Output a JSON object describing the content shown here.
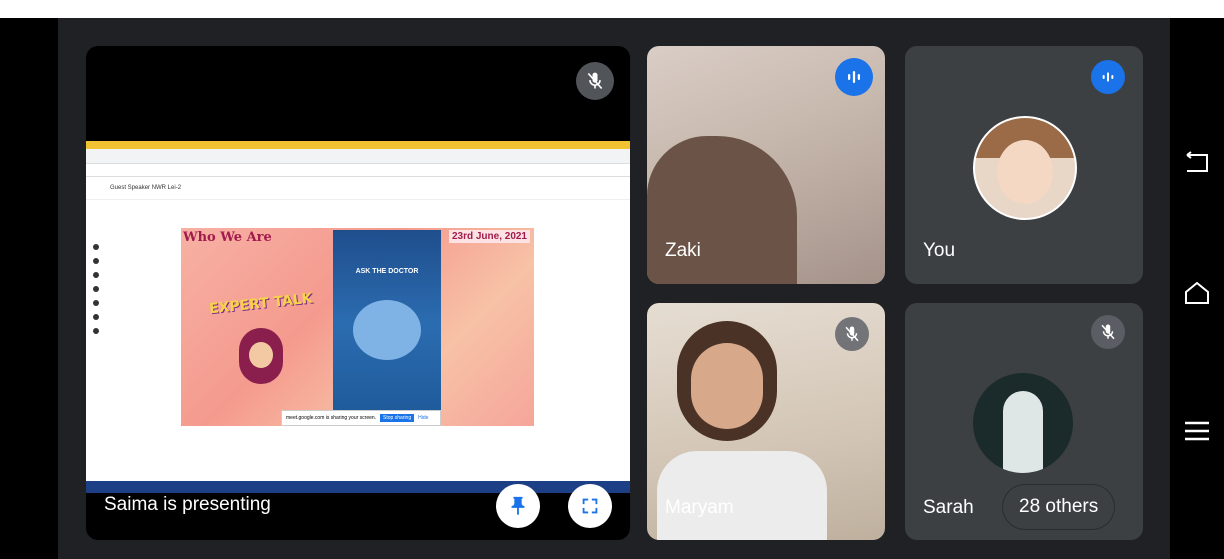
{
  "presentation": {
    "label": "Saima is presenting",
    "slide_title": "Who We Are",
    "slide_date": "23rd June, 2021",
    "slide_art_text": "EXPERT TALK",
    "poster_heading": "ASK THE DOCTOR",
    "doc_title": "Guest Speaker NWR Lei-2",
    "share_notice": "meet.google.com is sharing your screen.",
    "stop_sharing": "Stop sharing",
    "hide": "Hide"
  },
  "participants": [
    {
      "name": "Zaki",
      "state": "speaking"
    },
    {
      "name": "You",
      "state": "speaking"
    },
    {
      "name": "Maryam",
      "state": "muted"
    },
    {
      "name": "Sarah",
      "state": "muted"
    }
  ],
  "others_label": "28 others",
  "colors": {
    "background": "#202124",
    "tile": "#3c4043",
    "accent": "#1a73e8"
  },
  "icons": {
    "mic_off": "mic-off-icon",
    "speaking": "audio-wave-icon",
    "pin": "pin-icon",
    "fullscreen": "fullscreen-icon",
    "back": "back-icon",
    "home": "home-icon",
    "menu": "menu-icon"
  }
}
